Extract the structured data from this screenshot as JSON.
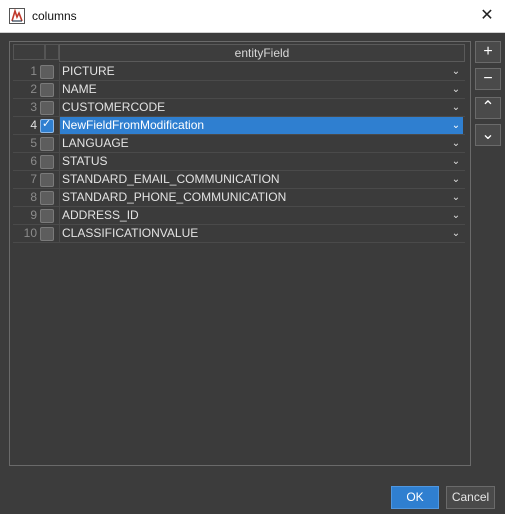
{
  "window": {
    "title": "columns",
    "close_glyph": "✕"
  },
  "table": {
    "header": "entityField",
    "rows": [
      {
        "num": "1",
        "field": "PICTURE",
        "checked": false
      },
      {
        "num": "2",
        "field": "NAME",
        "checked": false
      },
      {
        "num": "3",
        "field": "CUSTOMERCODE",
        "checked": false
      },
      {
        "num": "4",
        "field": "NewFieldFromModification",
        "checked": true,
        "selected": true
      },
      {
        "num": "5",
        "field": "LANGUAGE",
        "checked": false
      },
      {
        "num": "6",
        "field": "STATUS",
        "checked": false
      },
      {
        "num": "7",
        "field": "STANDARD_EMAIL_COMMUNICATION",
        "checked": false
      },
      {
        "num": "8",
        "field": "STANDARD_PHONE_COMMUNICATION",
        "checked": false
      },
      {
        "num": "9",
        "field": "ADDRESS_ID",
        "checked": false
      },
      {
        "num": "10",
        "field": "CLASSIFICATIONVALUE",
        "checked": false
      }
    ],
    "dropdown_glyph": "⌄"
  },
  "side_buttons": {
    "add": "+",
    "remove": "−",
    "move_up": "⌃",
    "move_down": "⌄"
  },
  "footer": {
    "ok_label": "OK",
    "cancel_label": "Cancel"
  },
  "colors": {
    "selection": "#2f7fd0",
    "background": "#3c3c3c"
  },
  "icons": {
    "app": "app-logo-icon",
    "close": "close-icon",
    "dropdown": "chevron-down-icon",
    "check": "check-icon"
  }
}
